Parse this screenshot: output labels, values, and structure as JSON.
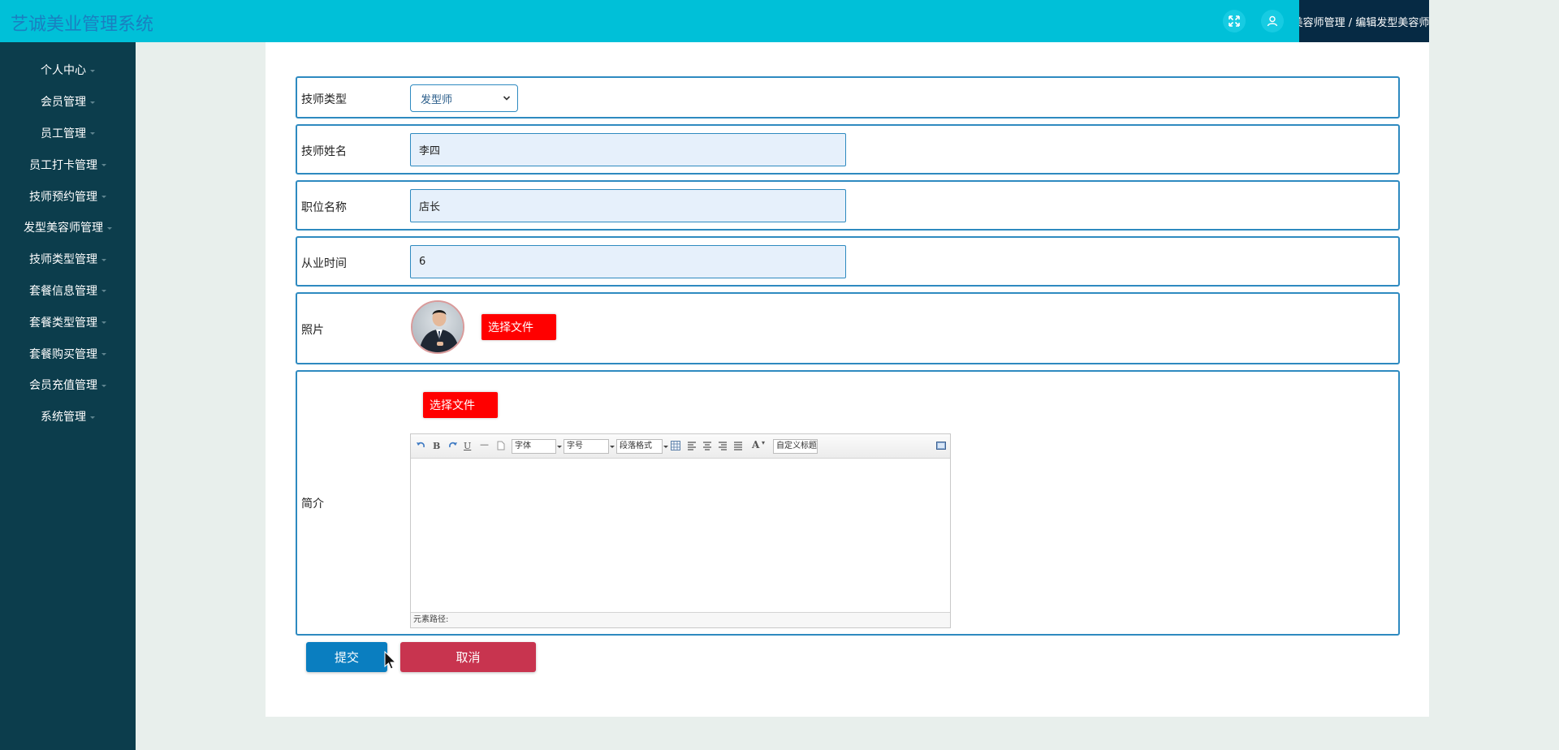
{
  "header": {
    "app_title": "艺诚美业管理系统",
    "fullscreen_icon": "fullscreen-icon",
    "user_icon": "user-icon",
    "breadcrumb": "发型美容师管理 / 编辑发型美容师"
  },
  "sidebar": {
    "items": [
      {
        "label": "个人中心"
      },
      {
        "label": "会员管理"
      },
      {
        "label": "员工管理"
      },
      {
        "label": "员工打卡管理"
      },
      {
        "label": "技师预约管理"
      },
      {
        "label": "发型美容师管理"
      },
      {
        "label": "技师类型管理"
      },
      {
        "label": "套餐信息管理"
      },
      {
        "label": "套餐类型管理"
      },
      {
        "label": "套餐购买管理"
      },
      {
        "label": "会员充值管理"
      },
      {
        "label": "系统管理"
      }
    ]
  },
  "form": {
    "type": {
      "label": "技师类型",
      "value": "发型师"
    },
    "name": {
      "label": "技师姓名",
      "value": "李四"
    },
    "position": {
      "label": "职位名称",
      "value": "店长"
    },
    "years": {
      "label": "从业时间",
      "value": "6"
    },
    "photo": {
      "label": "照片",
      "button": "选择文件"
    },
    "intro": {
      "label": "简介",
      "upload_button": "选择文件",
      "toolbar": {
        "font_family": "字体",
        "font_size": "字号",
        "paragraph": "段落格式",
        "custom_title": "自定义标题"
      },
      "status_path": "元素路径:"
    }
  },
  "actions": {
    "submit": "提交",
    "cancel": "取消"
  },
  "colors": {
    "header_bg": "#00c0d8",
    "sidebar_bg": "#0c3d4c",
    "breadcrumb_bg": "#062a44",
    "submit_bg": "#0a7ec0",
    "cancel_bg": "#c8344f",
    "upload_bg": "#ff0000",
    "field_border": "#2e8ac0"
  }
}
